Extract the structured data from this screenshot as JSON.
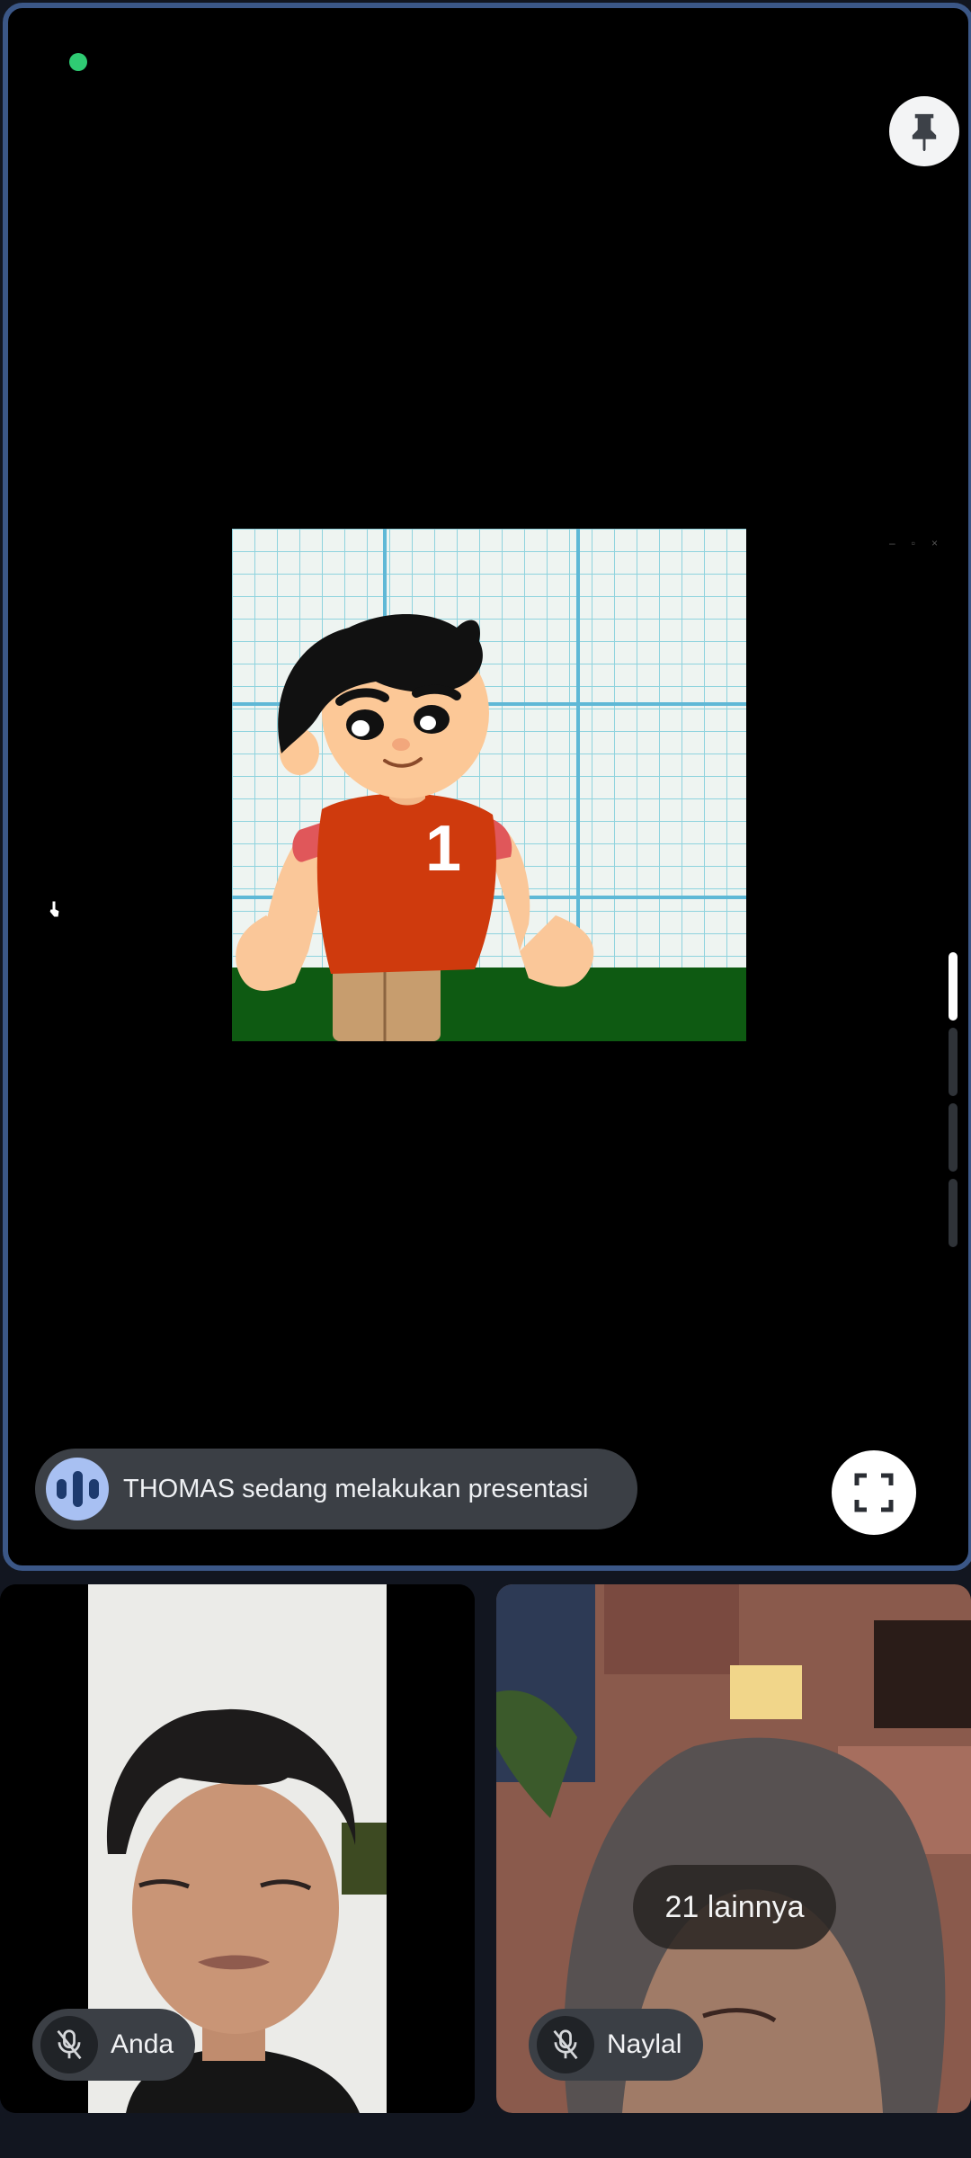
{
  "presentation": {
    "presenter_label": "THOMAS sedang melakukan presentasi",
    "shared_content": {
      "shirt_number": "1"
    },
    "window_controls": [
      "–",
      "▫",
      "×"
    ]
  },
  "participants": [
    {
      "name": "Anda",
      "mic": "muted"
    },
    {
      "name": "Naylal",
      "mic": "muted"
    }
  ],
  "more_participants_label": "21 lainnya",
  "colors": {
    "accent_border": "#3b5787",
    "status_dot": "#2fcb73",
    "chip_bg": "#3b3f45",
    "presenter_icon_bg": "#a8c0f2"
  },
  "icons": {
    "pin": "pin-icon",
    "fullscreen": "fullscreen-icon",
    "mic_off": "mic-off-icon",
    "presenting": "audio-wave-icon",
    "cursor": "hand-cursor-icon"
  }
}
